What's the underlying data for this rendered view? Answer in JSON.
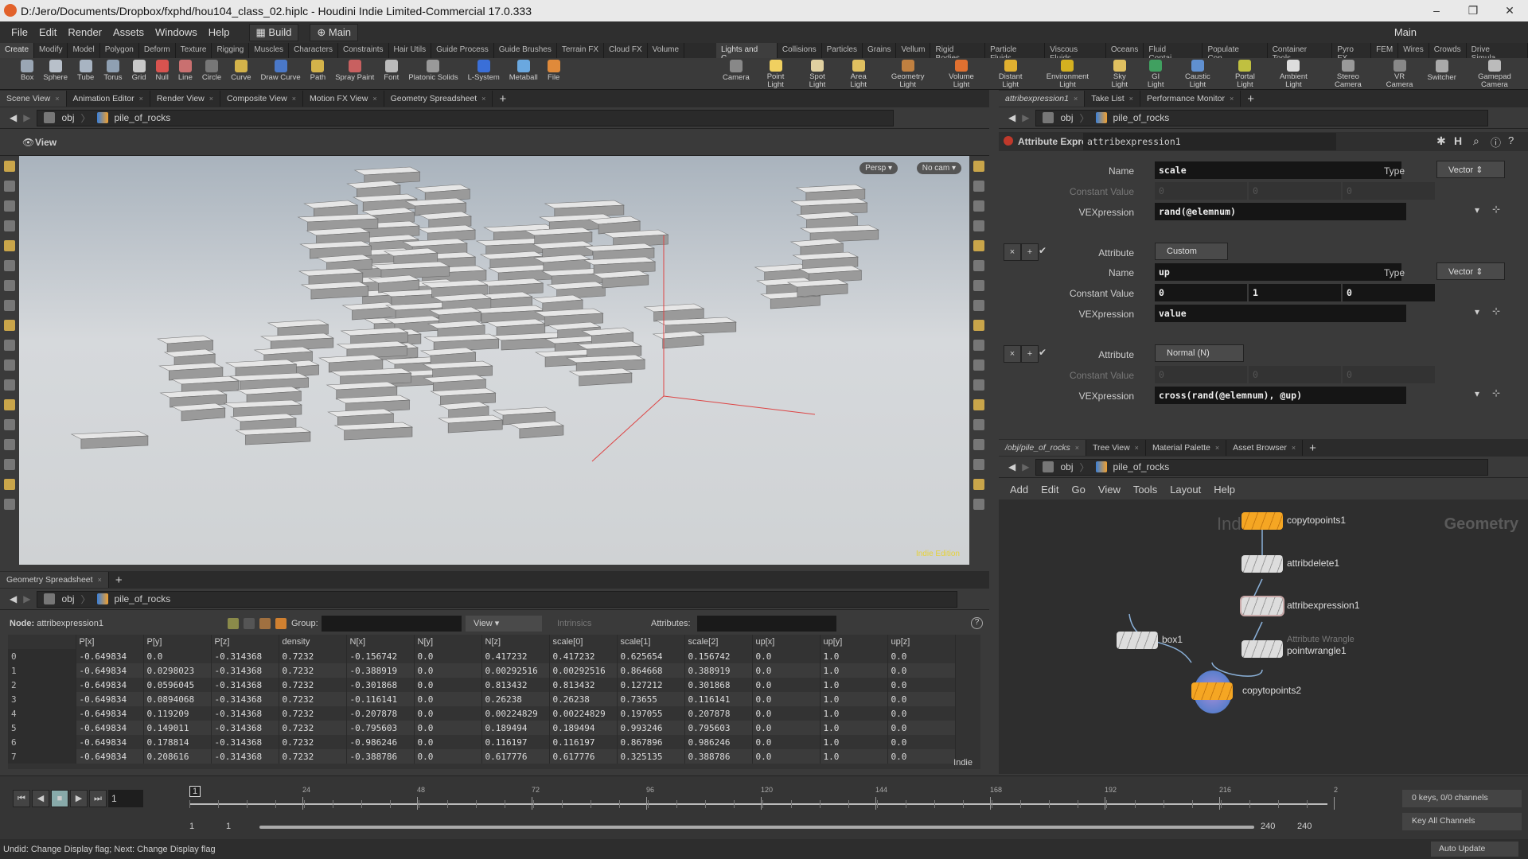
{
  "window": {
    "title": "D:/Jero/Documents/Dropbox/fxphd/hou104_class_02.hiplc - Houdini Indie Limited-Commercial 17.0.333",
    "min": "–",
    "max": "❐",
    "close": "✕"
  },
  "menu": {
    "items": [
      "File",
      "Edit",
      "Render",
      "Assets",
      "Windows",
      "Help"
    ],
    "desktop": "Build",
    "desktop2": "Main",
    "right_desktop": "Main"
  },
  "shelf_left": {
    "tabs": [
      "Create",
      "Modify",
      "Model",
      "Polygon",
      "Deform",
      "Texture",
      "Rigging",
      "Muscles",
      "Characters",
      "Constraints",
      "Hair Utils",
      "Guide Process",
      "Guide Brushes",
      "Terrain FX",
      "Cloud FX",
      "Volume"
    ],
    "tools": [
      {
        "label": "Box",
        "color": "#9aa6b4"
      },
      {
        "label": "Sphere",
        "color": "#b8c0ca"
      },
      {
        "label": "Tube",
        "color": "#a8b4c2"
      },
      {
        "label": "Torus",
        "color": "#8fa0b2"
      },
      {
        "label": "Grid",
        "color": "#c9c9c9"
      },
      {
        "label": "Null",
        "color": "#d9534f"
      },
      {
        "label": "Line",
        "color": "#c97070"
      },
      {
        "label": "Circle",
        "color": "#777777"
      },
      {
        "label": "Curve",
        "color": "#d4b34a"
      },
      {
        "label": "Draw Curve",
        "color": "#4a78c8"
      },
      {
        "label": "Path",
        "color": "#d4b34a"
      },
      {
        "label": "Spray Paint",
        "color": "#c86060"
      },
      {
        "label": "Font",
        "color": "#bbbbbb"
      },
      {
        "label": "Platonic Solids",
        "color": "#999999"
      },
      {
        "label": "L-System",
        "color": "#3a6fd8"
      },
      {
        "label": "Metaball",
        "color": "#6aa8e0"
      },
      {
        "label": "File",
        "color": "#e08a3a"
      }
    ]
  },
  "shelf_right": {
    "tabs": [
      "Lights and C...",
      "Collisions",
      "Particles",
      "Grains",
      "Vellum",
      "Rigid Bodies",
      "Particle Fluids",
      "Viscous Fluids",
      "Oceans",
      "Fluid Contai...",
      "Populate Con...",
      "Container Tools",
      "Pyro FX",
      "FEM",
      "Wires",
      "Crowds",
      "Drive Simula..."
    ],
    "tools": [
      {
        "label": "Camera",
        "color": "#888888"
      },
      {
        "label": "Point Light",
        "color": "#f0d060"
      },
      {
        "label": "Spot Light",
        "color": "#e0d0a0"
      },
      {
        "label": "Area Light",
        "color": "#e0c060"
      },
      {
        "label": "Geometry Light",
        "color": "#c08040"
      },
      {
        "label": "Volume Light",
        "color": "#e07030"
      },
      {
        "label": "Distant Light",
        "color": "#e0b030"
      },
      {
        "label": "Environment Light",
        "color": "#d4b020"
      },
      {
        "label": "Sky Light",
        "color": "#e0c060"
      },
      {
        "label": "GI Light",
        "color": "#40a060"
      },
      {
        "label": "Caustic Light",
        "color": "#6090d0"
      },
      {
        "label": "Portal Light",
        "color": "#c0c040"
      },
      {
        "label": "Ambient Light",
        "color": "#dddddd"
      },
      {
        "label": "Stereo Camera",
        "color": "#999999"
      },
      {
        "label": "VR Camera",
        "color": "#888888"
      },
      {
        "label": "Switcher",
        "color": "#aaaaaa"
      },
      {
        "label": "Gamepad Camera",
        "color": "#bbbbbb"
      }
    ]
  },
  "left_pane": {
    "tabs": [
      "Scene View",
      "Animation Editor",
      "Render View",
      "Composite View",
      "Motion FX View",
      "Geometry Spreadsheet"
    ],
    "path": [
      "obj",
      "pile_of_rocks"
    ],
    "view_label": "View",
    "persp": "Persp ▾",
    "cam": "No cam ▾",
    "edition": "Indie Edition"
  },
  "spreadsheet": {
    "tab": "Geometry Spreadsheet",
    "path": [
      "obj",
      "pile_of_rocks"
    ],
    "node_label": "Node:",
    "node": "attribexpression1",
    "group_label": "Group:",
    "view": "View",
    "intrinsics": "Intrinsics",
    "attributes_label": "Attributes:",
    "indie": "Indie",
    "columns": [
      "",
      "P[x]",
      "P[y]",
      "P[z]",
      "density",
      "N[x]",
      "N[y]",
      "N[z]",
      "scale[0]",
      "scale[1]",
      "scale[2]",
      "up[x]",
      "up[y]",
      "up[z]"
    ],
    "rows": [
      [
        "0",
        "-0.649834",
        "0.0",
        "-0.314368",
        "0.7232",
        "-0.156742",
        "0.0",
        "0.417232",
        "0.417232",
        "0.625654",
        "0.156742",
        "0.0",
        "1.0",
        "0.0"
      ],
      [
        "1",
        "-0.649834",
        "0.0298023",
        "-0.314368",
        "0.7232",
        "-0.388919",
        "0.0",
        "0.00292516",
        "0.00292516",
        "0.864668",
        "0.388919",
        "0.0",
        "1.0",
        "0.0"
      ],
      [
        "2",
        "-0.649834",
        "0.0596045",
        "-0.314368",
        "0.7232",
        "-0.301868",
        "0.0",
        "0.813432",
        "0.813432",
        "0.127212",
        "0.301868",
        "0.0",
        "1.0",
        "0.0"
      ],
      [
        "3",
        "-0.649834",
        "0.0894068",
        "-0.314368",
        "0.7232",
        "-0.116141",
        "0.0",
        "0.26238",
        "0.26238",
        "0.73655",
        "0.116141",
        "0.0",
        "1.0",
        "0.0"
      ],
      [
        "4",
        "-0.649834",
        "0.119209",
        "-0.314368",
        "0.7232",
        "-0.207878",
        "0.0",
        "0.00224829",
        "0.00224829",
        "0.197055",
        "0.207878",
        "0.0",
        "1.0",
        "0.0"
      ],
      [
        "5",
        "-0.649834",
        "0.149011",
        "-0.314368",
        "0.7232",
        "-0.795603",
        "0.0",
        "0.189494",
        "0.189494",
        "0.993246",
        "0.795603",
        "0.0",
        "1.0",
        "0.0"
      ],
      [
        "6",
        "-0.649834",
        "0.178814",
        "-0.314368",
        "0.7232",
        "-0.986246",
        "0.0",
        "0.116197",
        "0.116197",
        "0.867896",
        "0.986246",
        "0.0",
        "1.0",
        "0.0"
      ],
      [
        "7",
        "-0.649834",
        "0.208616",
        "-0.314368",
        "0.7232",
        "-0.388786",
        "0.0",
        "0.617776",
        "0.617776",
        "0.325135",
        "0.388786",
        "0.0",
        "1.0",
        "0.0"
      ]
    ]
  },
  "params_pane": {
    "tabs": [
      "attribexpression1",
      "Take List",
      "Performance Monitor"
    ],
    "path": [
      "obj",
      "pile_of_rocks"
    ],
    "node_type": "Attribute Expression",
    "node_name": "attribexpression1",
    "labels": {
      "name": "Name",
      "type": "Type",
      "constant": "Constant Value",
      "vex": "VEXpression",
      "attribute": "Attribute"
    },
    "block1": {
      "name": "scale",
      "type": "Vector",
      "constant": [
        "0",
        "0",
        "0"
      ],
      "vex": "rand(@elemnum)"
    },
    "block2": {
      "attribute": "Custom",
      "name": "up",
      "type": "Vector",
      "constant": [
        "0",
        "1",
        "0"
      ],
      "vex": "value"
    },
    "block3": {
      "attribute": "Normal (N)",
      "constant": [
        "0",
        "0",
        "0"
      ],
      "vex": "cross(rand(@elemnum), @up)"
    }
  },
  "network_pane": {
    "tabs": [
      "/obj/pile_of_rocks",
      "Tree View",
      "Material Palette",
      "Asset Browser"
    ],
    "path": [
      "obj",
      "pile_of_rocks"
    ],
    "menu": [
      "Add",
      "Edit",
      "Go",
      "View",
      "Tools",
      "Layout",
      "Help"
    ],
    "context": "Geometry",
    "watermark": "Ind",
    "nodes": [
      {
        "name": "copytopoints1"
      },
      {
        "name": "attribdelete1"
      },
      {
        "name": "attribexpression1"
      },
      {
        "name": "box1"
      },
      {
        "name": "pointwrangle1",
        "type": "Attribute Wrangle"
      },
      {
        "name": "copytopoints2"
      }
    ]
  },
  "timeline": {
    "frame": "1",
    "ticks": [
      "24",
      "48",
      "72",
      "96",
      "120",
      "144",
      "168",
      "192",
      "216",
      "2"
    ],
    "current_marker": "1",
    "range_start": "1",
    "range_start2": "1",
    "range_end": "240",
    "range_end2": "240",
    "keys": "0 keys, 0/0 channels",
    "key_all": "Key All Channels",
    "auto_update": "Auto Update"
  },
  "status": {
    "text": "Undid: Change Display flag; Next: Change Display flag"
  },
  "colors": {
    "accent_orange": "#f5a623",
    "panel": "#3a3a3a",
    "viewport_top": "#a9b3bd"
  }
}
